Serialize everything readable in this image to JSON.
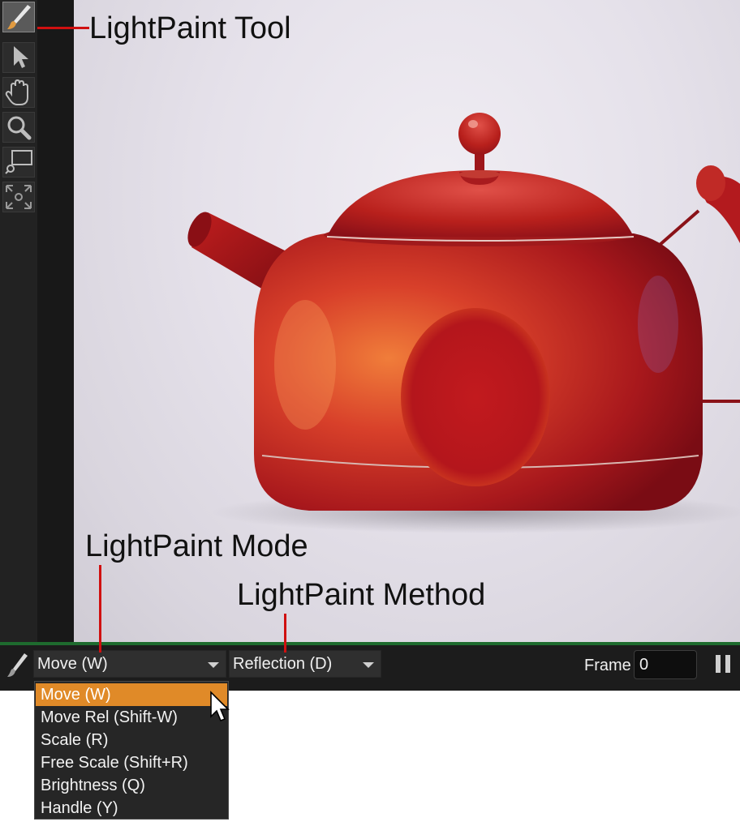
{
  "annotations": {
    "tool": "LightPaint Tool",
    "mode": "LightPaint Mode",
    "method": "LightPaint Method"
  },
  "toolbar": {
    "tools": [
      {
        "icon": "paintbrush-icon",
        "active": true
      },
      {
        "icon": "pointer-arrow-icon",
        "active": false
      },
      {
        "icon": "hand-icon",
        "active": false
      },
      {
        "icon": "magnifier-icon",
        "active": false
      },
      {
        "icon": "zoom-region-icon",
        "active": false
      },
      {
        "icon": "zoom-fit-icon",
        "active": false
      }
    ]
  },
  "bottombar": {
    "mode_value": "Move (W)",
    "method_value": "Reflection (D)",
    "frame_label": "Frame",
    "frame_value": "0"
  },
  "mode_menu": {
    "items": [
      "Move (W)",
      "Move Rel (Shift-W)",
      "Scale (R)",
      "Free Scale (Shift+R)",
      "Brightness (Q)",
      "Handle (Y)"
    ],
    "selected_index": 0
  },
  "colors": {
    "menu_highlight": "#e08a28",
    "status_line": "#1e6b2e",
    "annotation_leader": "#d01010",
    "teapot": "#b8201c"
  }
}
